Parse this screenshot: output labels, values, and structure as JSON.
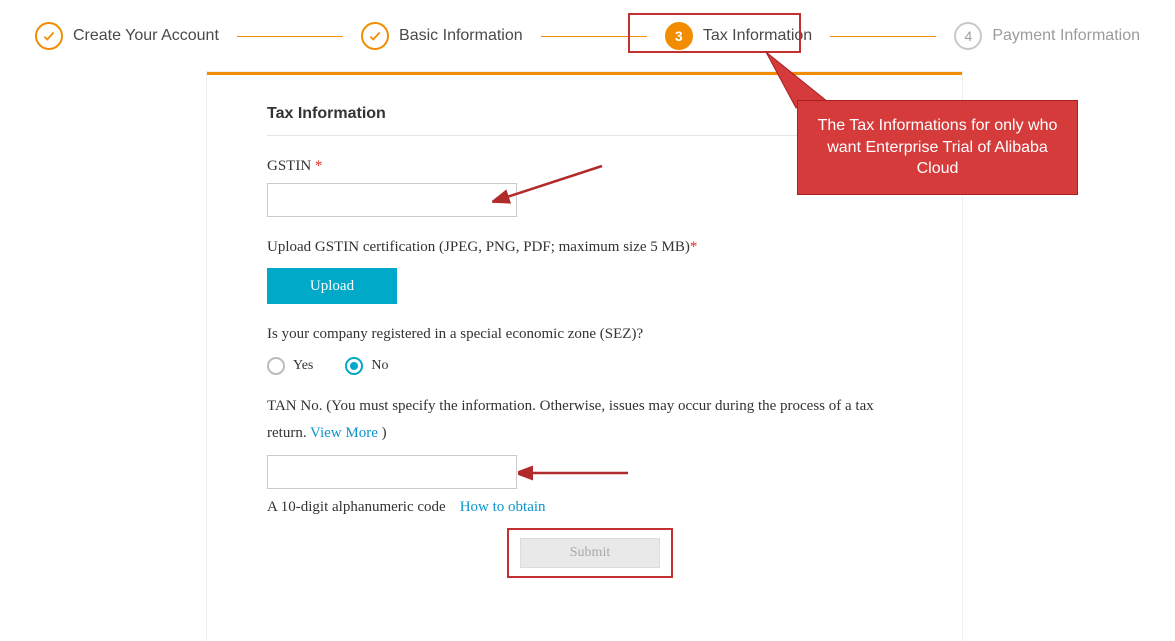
{
  "stepper": {
    "step1": {
      "label": "Create Your Account"
    },
    "step2": {
      "label": "Basic Information"
    },
    "step3": {
      "number": "3",
      "label": "Tax Information"
    },
    "step4": {
      "number": "4",
      "label": "Payment Information"
    }
  },
  "form": {
    "section_title": "Tax Information",
    "gstin_label": "GSTIN ",
    "gstin_required": "*",
    "gstin_value": "",
    "upload_label_pre": "Upload GSTIN certification (JPEG, PNG, PDF; maximum size 5 MB)",
    "upload_required": "*",
    "upload_button": "Upload",
    "sez_question": "Is your company registered in a special economic zone (SEZ)?",
    "sez_yes": "Yes",
    "sez_no": "No",
    "sez_selected": "no",
    "tan_label_1": "TAN No. (You must specify the information. Otherwise, issues may occur during the process of a tax return. ",
    "tan_view_more": "View More",
    "tan_label_2": " )",
    "tan_value": "",
    "tan_helper": "A 10-digit alphanumeric code",
    "tan_help_link": "How to obtain",
    "submit": "Submit"
  },
  "callout": {
    "text": "The Tax Informations for only who want Enterprise Trial of Alibaba Cloud"
  }
}
